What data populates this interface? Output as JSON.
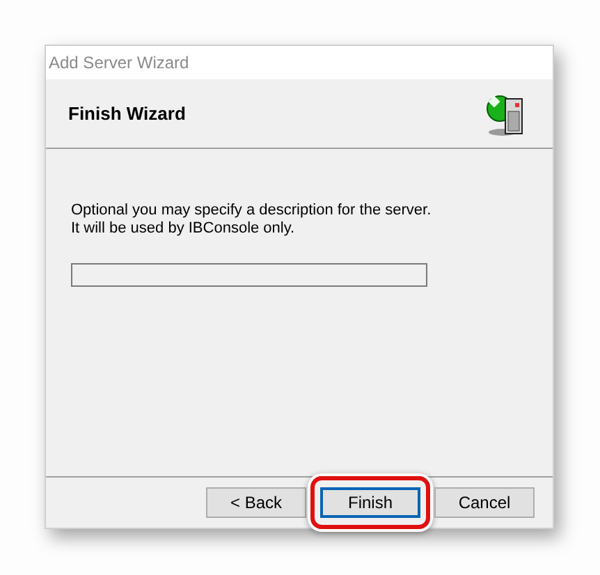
{
  "window": {
    "title": "Add Server Wizard"
  },
  "header": {
    "title": "Finish Wizard"
  },
  "description": [
    "Optional you may specify a description for the server.",
    "It will be used by IBConsole only."
  ],
  "buttons": [
    {
      "label": "< Back",
      "default": false,
      "highlighted": false
    },
    {
      "label": "Finish",
      "default": true,
      "highlighted": true
    },
    {
      "label": "Cancel",
      "default": false,
      "highlighted": false
    }
  ]
}
